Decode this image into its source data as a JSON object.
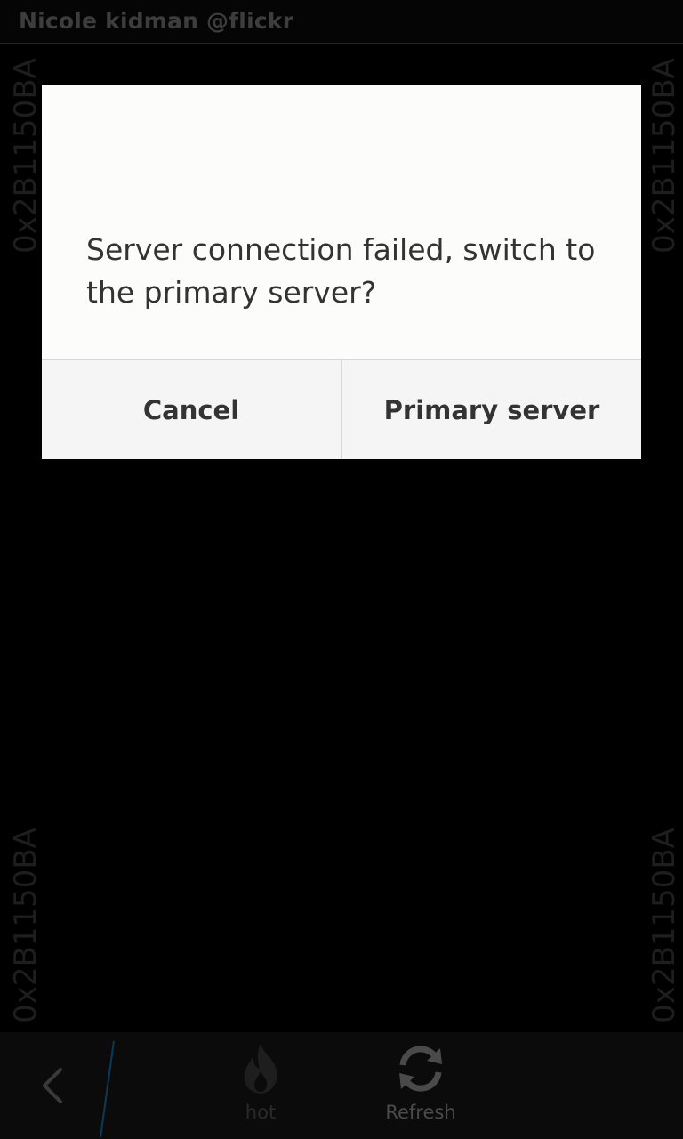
{
  "header": {
    "title": "Nicole kidman @flickr"
  },
  "watermark": {
    "text": "0x2B1150BA"
  },
  "dialog": {
    "message": "Server connection failed, switch to the primary server?",
    "buttons": {
      "cancel": "Cancel",
      "primary": "Primary server"
    }
  },
  "action_bar": {
    "back_icon": "chevron-left-icon",
    "actions": [
      {
        "label": "hot",
        "icon": "flame-icon"
      },
      {
        "label": "Refresh",
        "icon": "refresh-icon"
      }
    ]
  },
  "colors": {
    "background": "#000000",
    "dialog_background": "#fcfdfb",
    "dialog_button_background": "#f5f5f5",
    "dialog_text": "#333333",
    "accent_divider": "#0a3a5a"
  }
}
